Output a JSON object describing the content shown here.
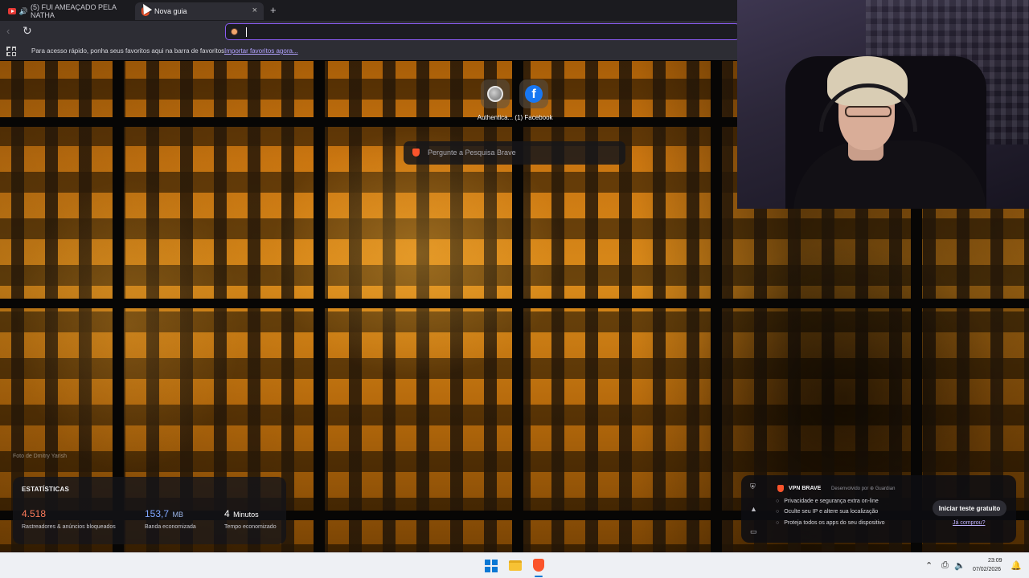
{
  "tabs": [
    {
      "title": "(5) FUI AMEAÇADO PELA NATHA",
      "active": false,
      "audible": true
    },
    {
      "title": "Nova guia",
      "active": true
    }
  ],
  "toolbar": {
    "url_value": "",
    "new_tab_symbol": "+",
    "close_symbol": "×"
  },
  "bookmarks_bar": {
    "hint": "Para acesso rápido, ponha seus favoritos aqui na barra de favoritos.",
    "import_link": "Importar favoritos agora..."
  },
  "top_sites": [
    {
      "label": "Authentica...",
      "icon": "globe-icon"
    },
    {
      "label": "(1) Facebook",
      "icon": "facebook-icon"
    }
  ],
  "search": {
    "placeholder": "Pergunte a Pesquisa Brave"
  },
  "background": {
    "photo_credit": "Foto de Dmitry Yarish"
  },
  "stats": {
    "title": "ESTATÍSTICAS",
    "items": [
      {
        "value": "4.518",
        "unit": "",
        "label": "Rastreadores & anúncios bloqueados",
        "color": "#fb7a5a"
      },
      {
        "value": "153,7",
        "unit": "MB",
        "label": "Banda economizada",
        "color": "#7fa6ff"
      },
      {
        "value": "4",
        "unit": "Minutos",
        "label": "Tempo economizado",
        "color": "#ffffff"
      }
    ]
  },
  "vpn": {
    "title": "VPN BRAVE",
    "developer": "Desenvolvido por ⊕ Guardian",
    "features": [
      "Privacidade e segurança extra on-line",
      "Oculte seu IP e altere sua localização",
      "Proteja todos os apps do seu dispositivo"
    ],
    "cta": "Iniciar teste gratuito",
    "bought_link": "Já comprou?"
  },
  "taskbar": {
    "time": "23:09",
    "date": "07/02/2026"
  },
  "colors": {
    "accent": "#8b5cf6",
    "brave_orange": "#fb542b",
    "facebook_blue": "#1877f2"
  }
}
